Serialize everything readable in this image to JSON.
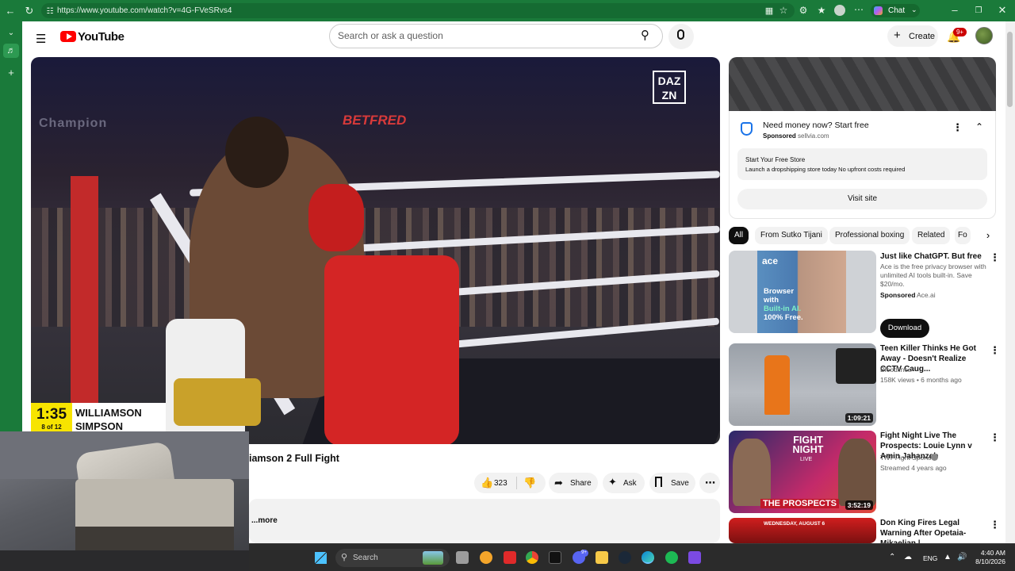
{
  "browser": {
    "url": "https://www.youtube.com/watch?v=4G-FVeSRvs4",
    "chat_label": "Chat"
  },
  "masthead": {
    "logo_text": "YouTube",
    "search_placeholder": "Search or ask a question",
    "create_label": "Create",
    "notification_count": "9+"
  },
  "video": {
    "dazn_logo": "DAZ N",
    "dazn_line1": "DAZ",
    "dazn_line2": "ZN",
    "score_time": "1:35",
    "score_round": "8 of 12",
    "score_name1": "WILLIAMSON",
    "score_name2": "SIMPSON",
    "sponsor_text": "BETFRED"
  },
  "watch": {
    "title_visible": "iamson 2 Full Fight",
    "like_count": "323",
    "share_label": "Share",
    "ask_label": "Ask",
    "save_label": "Save",
    "more_label": "...more"
  },
  "ad": {
    "title": "Need money now? Start free",
    "sponsored": "Sponsored",
    "domain": "sellvia.com",
    "inner_title": "Start Your Free Store",
    "inner_desc": "Launch a dropshipping store today No upfront costs required",
    "visit_label": "Visit site"
  },
  "chips": [
    "All",
    "From Sutko Tijani",
    "Professional boxing",
    "Related",
    "Fo"
  ],
  "recommendations": [
    {
      "title": "Just like ChatGPT. But free",
      "desc": "Ace is the free privacy browser with unlimited AI tools built-in. Save $20/mo.",
      "sponsored": "Sponsored",
      "channel": "Ace.ai",
      "cta": "Download",
      "thumb_brand": "ace",
      "thumb_text": "Browser with Built-in AI. 100% Free.",
      "thumb_line1": "Browser",
      "thumb_line2": "with",
      "thumb_line3": "Built-in AI.",
      "thumb_line4": "100% Free."
    },
    {
      "title": "Teen Killer Thinks He Got Away - Doesn't Realize CCTV Caug...",
      "channel": "Bloodlines",
      "meta": "158K views • 6 months ago",
      "duration": "1:09:21"
    },
    {
      "title": "Fight Night Live The Prospects: Louie Lynn v Amin Jahanzeb",
      "channel": "TNT Fight Sports",
      "meta": "Streamed 4 years ago",
      "duration": "3:52:19",
      "thumb_top": "FIGHT NIGHT",
      "thumb_live": "LIVE",
      "thumb_bottom": "THE PROSPECTS"
    },
    {
      "title": "Don King Fires Legal Warning After Opetaia-Mikaelian | ...",
      "channel": "",
      "thumb_banner": "WEDNESDAY, AUGUST 6"
    }
  ],
  "taskbar": {
    "search_label": "Search",
    "lang": "ENG",
    "time": "4:40 AM",
    "date": "8/10/2026",
    "discord_badge": "9+"
  },
  "colors": {
    "browser_chrome": "#1a7a3a",
    "youtube_red": "#ff0000",
    "score_yellow": "#f7e400",
    "taskbar": "#2b2b2b"
  }
}
